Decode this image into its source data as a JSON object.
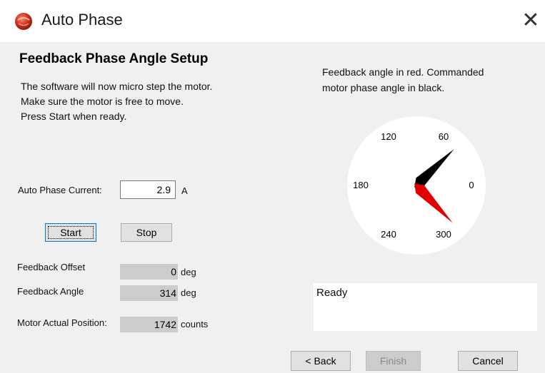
{
  "window": {
    "title": "Auto Phase",
    "close_symbol": "✕"
  },
  "page": {
    "heading": "Feedback Phase Angle Setup",
    "intro_lines": [
      "The software will now micro step the motor.",
      "Make sure the motor is free to move.",
      "Press Start when ready."
    ],
    "dial_caption_lines": [
      "Feedback angle in red.  Commanded",
      "motor phase angle in black."
    ]
  },
  "current": {
    "label": "Auto Phase Current:",
    "value": "2.9",
    "unit": "A"
  },
  "buttons": {
    "start": "Start",
    "stop": "Stop",
    "back": "< Back",
    "finish": "Finish",
    "cancel": "Cancel"
  },
  "readouts": {
    "offset": {
      "label": "Feedback Offset",
      "value": "0",
      "unit": "deg"
    },
    "angle": {
      "label": "Feedback Angle",
      "value": "314",
      "unit": "deg"
    },
    "position": {
      "label": "Motor Actual Position:",
      "value": "1742",
      "unit": "counts"
    }
  },
  "dial": {
    "tick_labels": [
      "0",
      "60",
      "120",
      "180",
      "240",
      "300"
    ],
    "feedback_angle_deg": 314,
    "commanded_angle_deg": 44,
    "feedback_color": "#e00000",
    "commanded_color": "#000000"
  },
  "status": {
    "text": "Ready"
  },
  "icons": {
    "app": "app-logo-icon",
    "close": "close-icon"
  }
}
